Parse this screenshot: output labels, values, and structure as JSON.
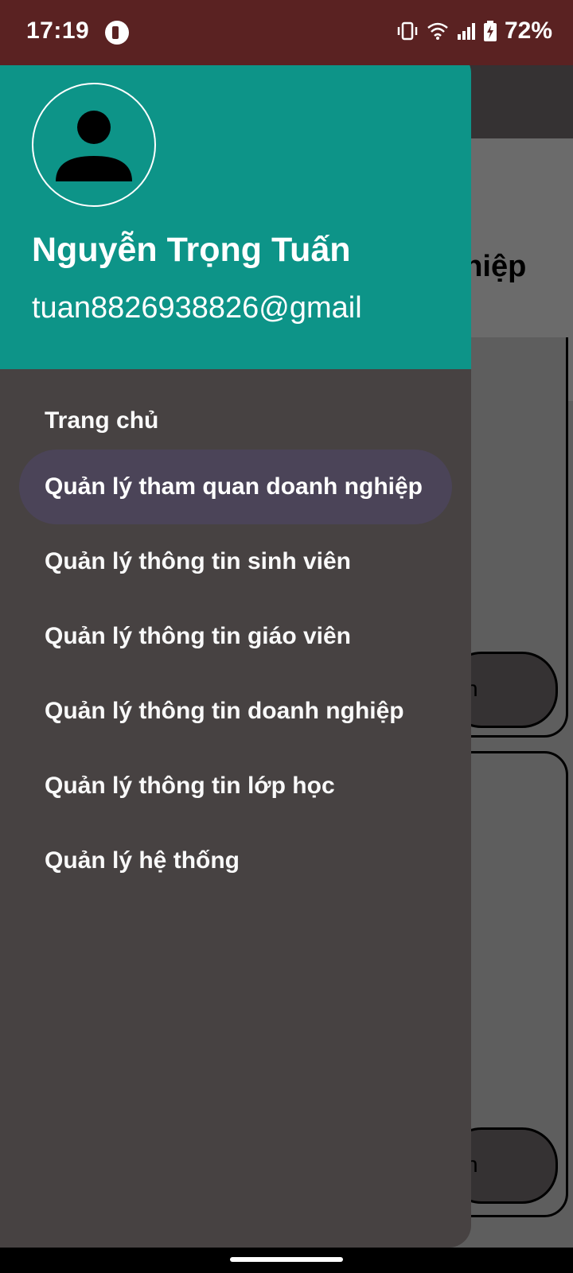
{
  "status_bar": {
    "time": "17:19",
    "battery_percent": "72%",
    "icons": [
      "app-notification-icon",
      "vibrate-icon",
      "wifi-icon",
      "signal-icon",
      "battery-charging-icon"
    ]
  },
  "background": {
    "partial_title": "nhiệp",
    "partial_button_text": "n"
  },
  "drawer": {
    "user": {
      "name": "Nguyễn Trọng Tuấn",
      "email": "tuan8826938826@gmail"
    },
    "menu_items": [
      {
        "label": "Trang chủ",
        "active": false
      },
      {
        "label": "Quản lý tham quan doanh nghiệp",
        "active": true
      },
      {
        "label": "Quản lý thông tin sinh viên",
        "active": false
      },
      {
        "label": "Quản lý thông tin giáo viên",
        "active": false
      },
      {
        "label": "Quản lý thông tin doanh nghiệp",
        "active": false
      },
      {
        "label": "Quản lý thông tin lớp học",
        "active": false
      },
      {
        "label": "Quản lý hệ thống",
        "active": false
      }
    ]
  },
  "colors": {
    "status_bar": "#5a2222",
    "drawer_header": "#0d9488",
    "drawer_bg": "#474242",
    "active_item_bg": "#4b4458"
  }
}
